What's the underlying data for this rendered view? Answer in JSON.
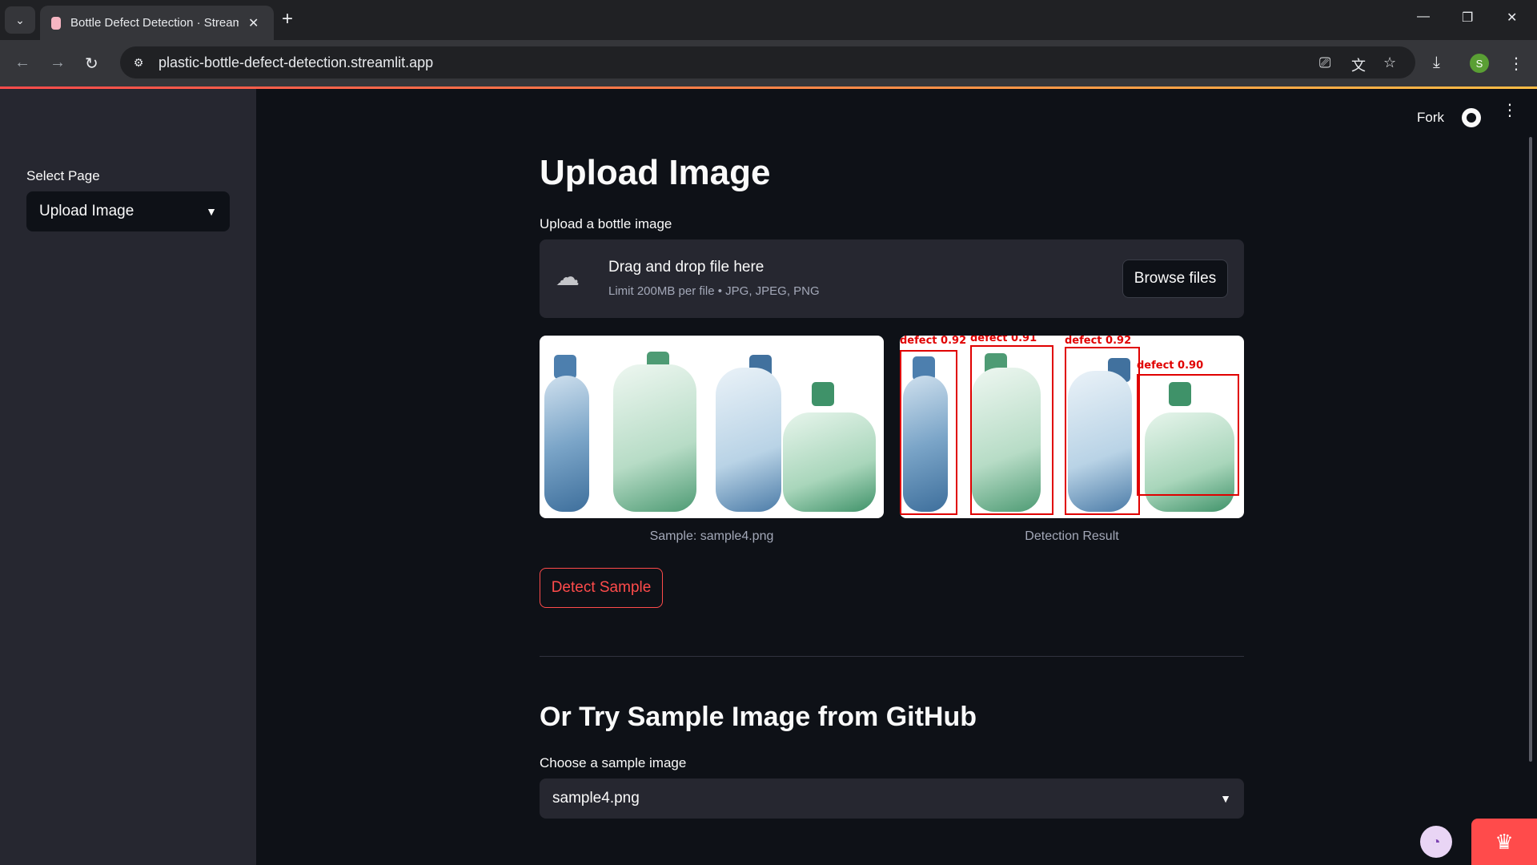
{
  "browser": {
    "tab_title": "Bottle Defect Detection · Streamlit",
    "url": "plastic-bottle-defect-detection.streamlit.app",
    "profile_initial": "S"
  },
  "sidebar": {
    "select_label": "Select Page",
    "select_value": "Upload Image"
  },
  "header": {
    "fork_label": "Fork"
  },
  "main": {
    "title": "Upload Image",
    "upload_label": "Upload a bottle image",
    "dropzone_title": "Drag and drop file here",
    "dropzone_limit": "Limit 200MB per file • JPG, JPEG, PNG",
    "browse_label": "Browse files",
    "sample_caption": "Sample: sample4.png",
    "result_caption": "Detection Result",
    "detections": [
      {
        "label": "defect  0.92"
      },
      {
        "label": "defect  0.91"
      },
      {
        "label": "defect  0.92"
      },
      {
        "label": "defect  0.90"
      }
    ],
    "detect_button": "Detect Sample",
    "section_title": "Or Try Sample Image from GitHub",
    "sample_select_label": "Choose a sample image",
    "sample_select_value": "sample4.png"
  },
  "colors": {
    "accent": "#ff4b4b",
    "background": "#0e1117",
    "sidebar": "#262730"
  }
}
